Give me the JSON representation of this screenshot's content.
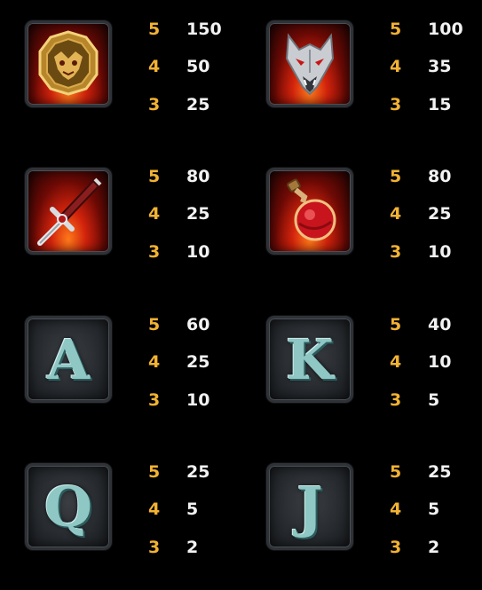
{
  "paytable": [
    {
      "id": "dragon",
      "icon": "dragon-medallion-icon",
      "pays": [
        {
          "count": "5",
          "value": "150"
        },
        {
          "count": "4",
          "value": "50"
        },
        {
          "count": "3",
          "value": "25"
        }
      ]
    },
    {
      "id": "wolf",
      "icon": "wolf-head-icon",
      "pays": [
        {
          "count": "5",
          "value": "100"
        },
        {
          "count": "4",
          "value": "35"
        },
        {
          "count": "3",
          "value": "15"
        }
      ]
    },
    {
      "id": "sword",
      "icon": "sword-icon",
      "pays": [
        {
          "count": "5",
          "value": "80"
        },
        {
          "count": "4",
          "value": "25"
        },
        {
          "count": "3",
          "value": "10"
        }
      ]
    },
    {
      "id": "potion",
      "icon": "potion-icon",
      "pays": [
        {
          "count": "5",
          "value": "80"
        },
        {
          "count": "4",
          "value": "25"
        },
        {
          "count": "3",
          "value": "10"
        }
      ]
    },
    {
      "id": "ace",
      "icon": "letter-a-icon",
      "letter": "A",
      "pays": [
        {
          "count": "5",
          "value": "60"
        },
        {
          "count": "4",
          "value": "25"
        },
        {
          "count": "3",
          "value": "10"
        }
      ]
    },
    {
      "id": "king",
      "icon": "letter-k-icon",
      "letter": "K",
      "pays": [
        {
          "count": "5",
          "value": "40"
        },
        {
          "count": "4",
          "value": "10"
        },
        {
          "count": "3",
          "value": "5"
        }
      ]
    },
    {
      "id": "queen",
      "icon": "letter-q-icon",
      "letter": "Q",
      "pays": [
        {
          "count": "5",
          "value": "25"
        },
        {
          "count": "4",
          "value": "5"
        },
        {
          "count": "3",
          "value": "2"
        }
      ]
    },
    {
      "id": "jack",
      "icon": "letter-j-icon",
      "letter": "J",
      "pays": [
        {
          "count": "5",
          "value": "25"
        },
        {
          "count": "4",
          "value": "5"
        },
        {
          "count": "3",
          "value": "2"
        }
      ]
    }
  ],
  "colors": {
    "multiplier": "#f2b233",
    "payout": "#f2f2f2",
    "background": "#000000",
    "letter": "#8fc7c4"
  }
}
